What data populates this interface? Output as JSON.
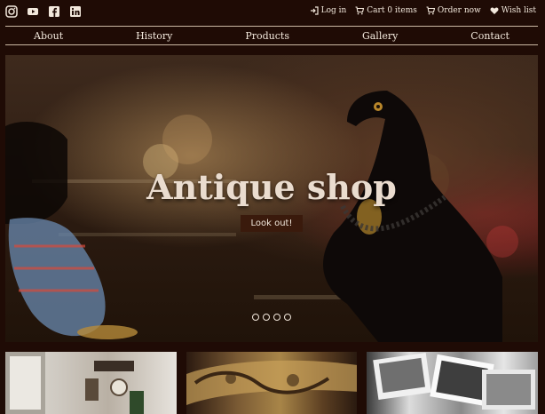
{
  "header": {
    "social": [
      "instagram-icon",
      "youtube-icon",
      "facebook-icon",
      "linkedin-icon"
    ],
    "actions": [
      {
        "label": "Log in",
        "icon": "login-icon"
      },
      {
        "label": "Cart 0 items",
        "icon": "cart-icon"
      },
      {
        "label": "Order now",
        "icon": "cart-icon"
      },
      {
        "label": "Wish list",
        "icon": "heart-icon"
      }
    ]
  },
  "nav": {
    "items": [
      "About",
      "History",
      "Products",
      "Gallery",
      "Contact"
    ]
  },
  "hero": {
    "title": "Antique shop",
    "button": "Look out!",
    "slides": 4
  },
  "gallery": {
    "thumbnails": [
      "vintage-room",
      "carved-wood",
      "old-photographs"
    ]
  },
  "colors": {
    "background": "#1f0b05",
    "accent": "#3a1a0c",
    "text": "#f2e8dc"
  }
}
